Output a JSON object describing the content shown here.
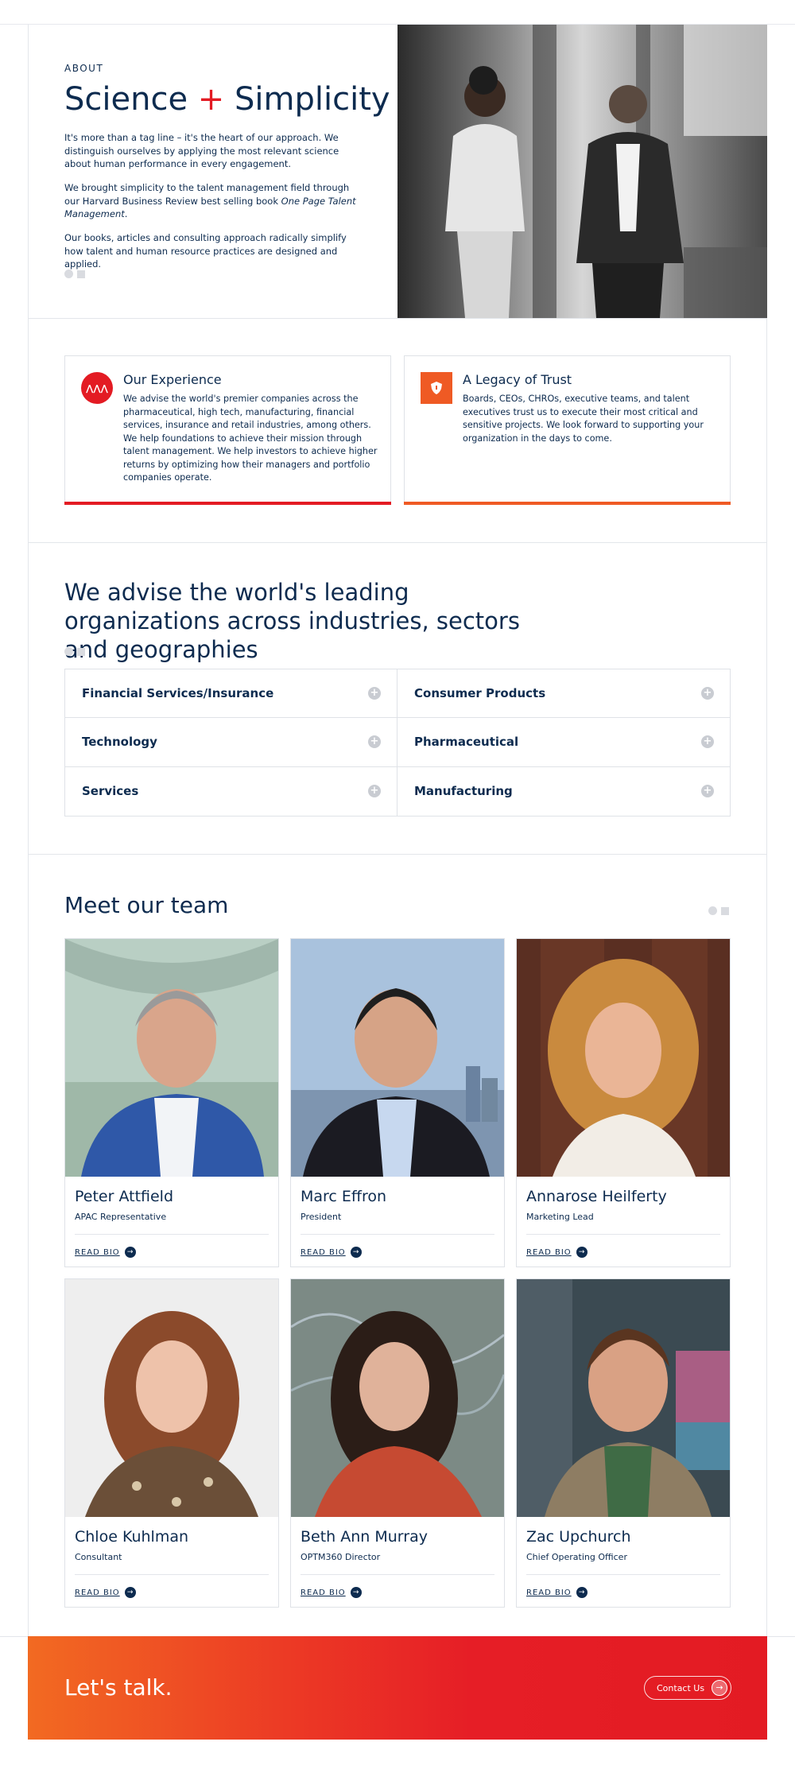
{
  "hero": {
    "eyebrow": "ABOUT",
    "title_part1": "Science",
    "title_plus": "+",
    "title_part2": "Simplicity",
    "paragraph1": "It's more than a tag line – it's the heart of our approach. We distinguish ourselves by applying the most relevant science about human performance in every engagement.",
    "paragraph2_start": "We brought simplicity to the talent management field through our Harvard Business Review best selling book ",
    "paragraph2_italic": "One Page Talent Management",
    "paragraph2_end": ".",
    "paragraph3": "Our books, articles and consulting approach radically simplify how talent and human resource practices are designed and applied."
  },
  "cards": [
    {
      "title": "Our Experience",
      "icon": "triple-figure-icon",
      "text": "We advise the world's premier companies across the pharmaceutical, high tech, manufacturing, financial services, insurance and retail industries, among others. We help foundations to achieve their mission through talent management. We help investors to achieve higher returns by optimizing how their managers and portfolio companies operate.",
      "accent": "#e31b23"
    },
    {
      "title": "A Legacy of Trust",
      "icon": "shield-icon",
      "text": "Boards, CEOs, CHROs, executive teams, and talent executives trust us to execute their most critical and sensitive projects. We look forward to supporting your organization in the days to come.",
      "accent": "#ef5a24"
    }
  ],
  "industries": {
    "title": "We advise the world's leading organizations across industries, sectors and geographies",
    "items": [
      "Financial Services/Insurance",
      "Consumer Products",
      "Technology",
      "Pharmaceutical",
      "Services",
      "Manufacturing"
    ]
  },
  "team": {
    "title": "Meet our team",
    "read_bio_label": "READ BIO",
    "members": [
      {
        "name": "Peter Attfield",
        "role": "APAC Representative"
      },
      {
        "name": "Marc Effron",
        "role": "President"
      },
      {
        "name": "Annarose Heilferty",
        "role": "Marketing Lead"
      },
      {
        "name": "Chloe Kuhlman",
        "role": "Consultant"
      },
      {
        "name": "Beth Ann Murray",
        "role": "OPTM360 Director"
      },
      {
        "name": "Zac Upchurch",
        "role": "Chief Operating Officer"
      }
    ]
  },
  "cta": {
    "title": "Let's talk.",
    "button_label": "Contact Us"
  },
  "colors": {
    "navy": "#0d2b4f",
    "red": "#e31b23",
    "orange": "#ef5a24"
  }
}
